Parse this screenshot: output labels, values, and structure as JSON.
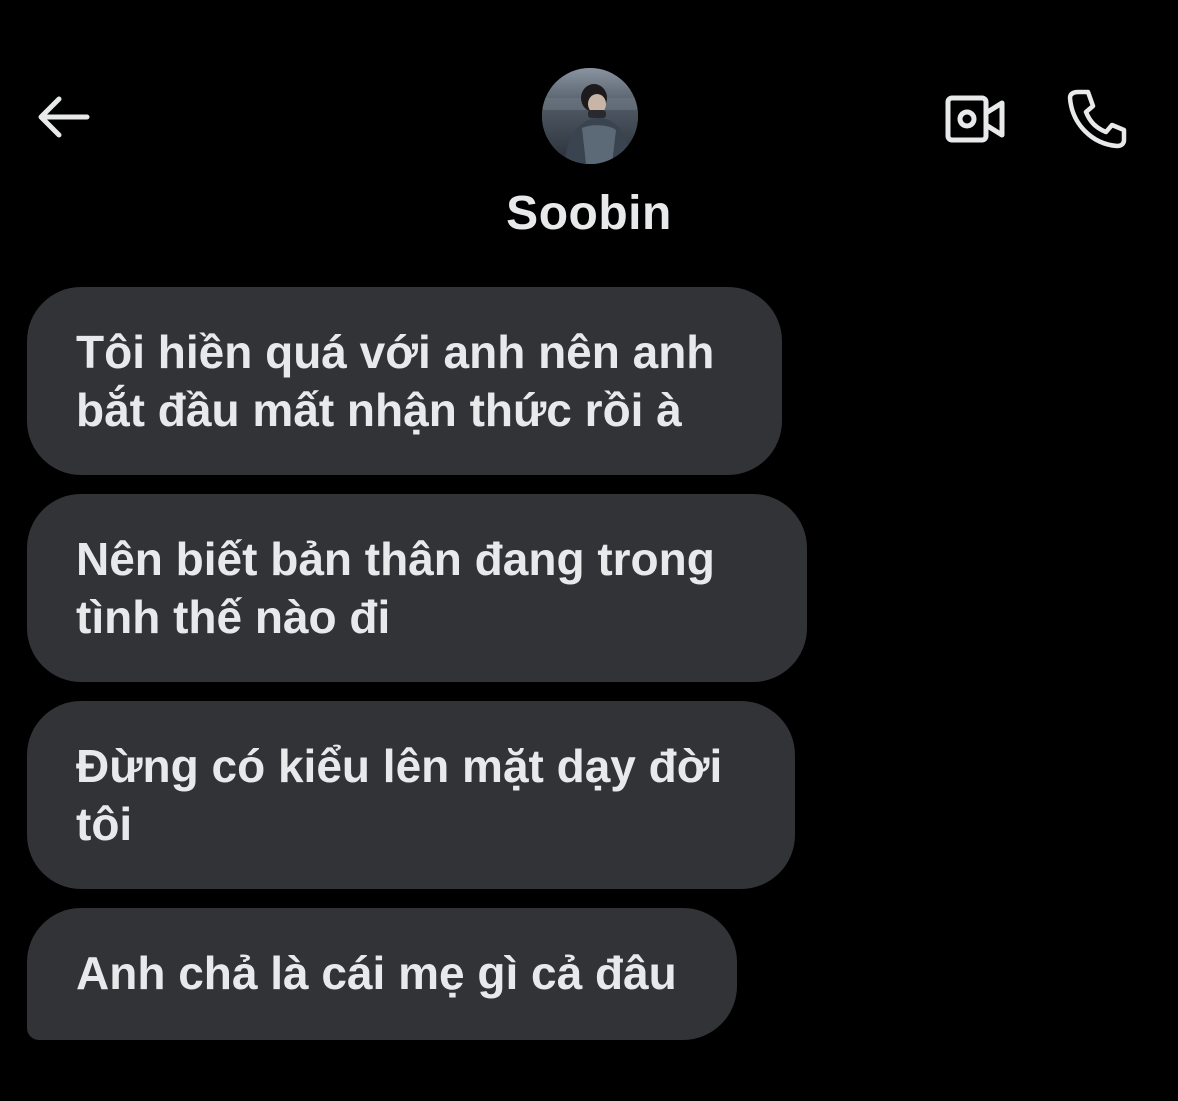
{
  "header": {
    "back_icon": "arrow-left-icon",
    "contact_name": "Soobin",
    "avatar_alt": "Soobin",
    "video_icon": "video-camera-icon",
    "phone_icon": "phone-icon"
  },
  "messages": [
    {
      "text": "Tôi hiền quá với anh nên anh bắt đầu mất nhận thức rồi à",
      "direction": "incoming"
    },
    {
      "text": "Nên biết bản thân đang trong tình thế nào đi",
      "direction": "incoming"
    },
    {
      "text": "Đừng có kiểu lên mặt dạy đời tôi",
      "direction": "incoming"
    },
    {
      "text": "Anh chả là cái mẹ gì cả đâu",
      "direction": "incoming"
    }
  ],
  "colors": {
    "background": "#000000",
    "bubble": "#323337",
    "text": "#e7e9ea"
  }
}
